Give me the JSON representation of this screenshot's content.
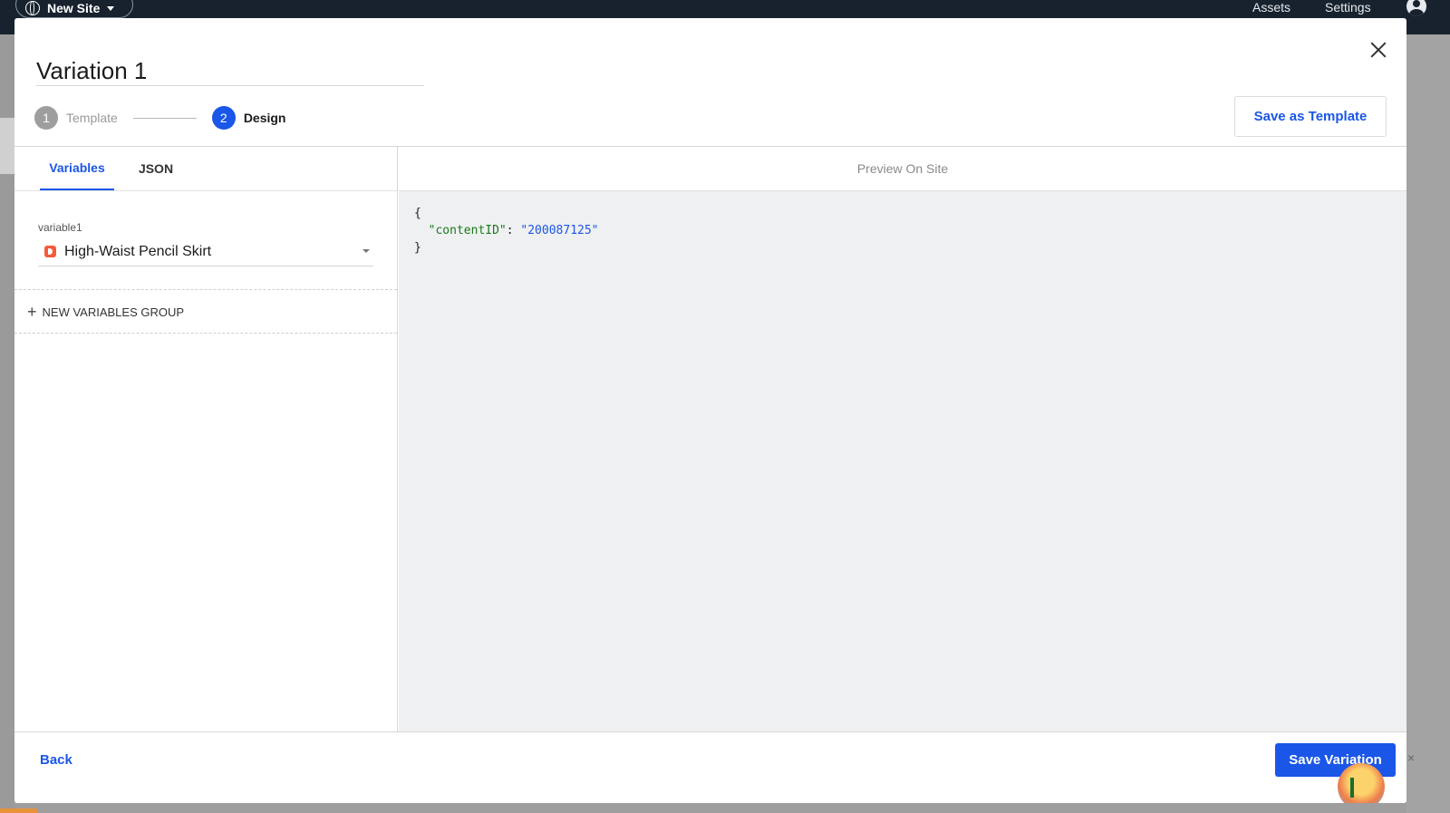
{
  "topbar": {
    "site_label": "New Site",
    "nav": [
      "Assets",
      "Settings"
    ]
  },
  "modal": {
    "title": "Variation 1",
    "close_icon": "close-icon",
    "steps": [
      {
        "number": "1",
        "label": "Template",
        "state": "done",
        "color": "#9e9e9e"
      },
      {
        "number": "2",
        "label": "Design",
        "state": "active",
        "color": "#1a56e8"
      }
    ],
    "save_template_label": "Save as Template",
    "tabs": [
      "Variables",
      "JSON"
    ],
    "variable": {
      "label": "variable1",
      "value": "High-Waist Pencil Skirt"
    },
    "new_group_label": "NEW VARIABLES GROUP",
    "preview_label": "Preview On Site",
    "json": {
      "open": "{",
      "key": "\"contentID\"",
      "colon": ": ",
      "value": "\"200087125\"",
      "close": "}"
    },
    "back_label": "Back",
    "save_variation_label": "Save Variation"
  },
  "colors": {
    "accent": "#1a56e8",
    "topbar": "#18222f",
    "product_icon": "#f45b3a"
  }
}
